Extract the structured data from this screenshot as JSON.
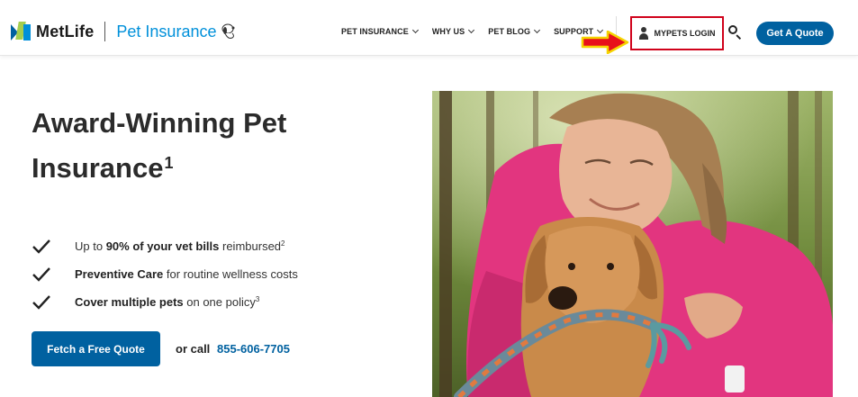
{
  "header": {
    "brand": "MetLife",
    "product": "Pet Insurance",
    "nav": [
      {
        "label": "PET INSURANCE"
      },
      {
        "label": "WHY US"
      },
      {
        "label": "PET BLOG"
      },
      {
        "label": "SUPPORT"
      }
    ],
    "login_label": "MYPETS LOGIN",
    "quote_label": "Get A Quote",
    "icons": {
      "search": "search-icon",
      "person": "person-icon",
      "arrow": "arrow-right-icon"
    }
  },
  "hero": {
    "title_line1": "Award-Winning Pet",
    "title_line2": "Insurance",
    "title_sup": "1",
    "benefits": [
      {
        "pre": "Up to ",
        "bold": "90% of your vet bills",
        "post": " reimbursed",
        "sup": "2"
      },
      {
        "pre": "",
        "bold": "Preventive Care",
        "post": " for routine wellness costs",
        "sup": ""
      },
      {
        "pre": "",
        "bold": "Cover multiple pets",
        "post": " on one policy",
        "sup": "3"
      }
    ],
    "cta_label": "Fetch a Free Quote",
    "or_call": "or call",
    "phone": "855-606-7705"
  },
  "colors": {
    "primary": "#0061a0",
    "accent": "#0090da",
    "highlight_border": "#d0021b",
    "arrow": "#e8101a",
    "arrow_outline": "#f5d400"
  }
}
